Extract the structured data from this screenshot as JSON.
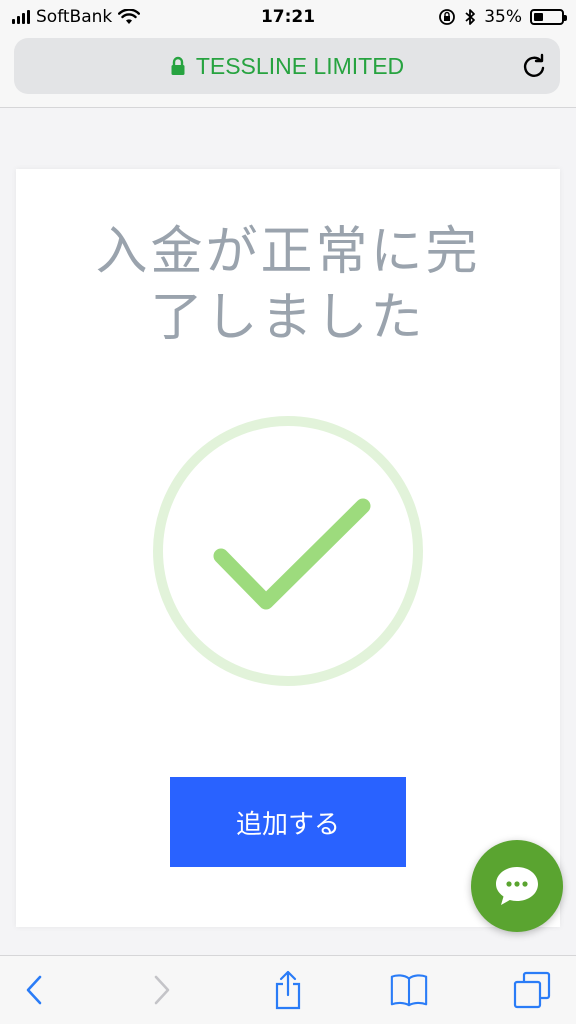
{
  "status_bar": {
    "carrier": "SoftBank",
    "time": "17:21",
    "battery_percent": "35%",
    "battery_level": 0.35,
    "icons": [
      "signal-icon",
      "wifi-icon",
      "orientation-lock-icon",
      "bluetooth-icon",
      "battery-icon"
    ]
  },
  "browser": {
    "url_title": "TESSLINE LIMITED",
    "secure": true,
    "accent_color": "#27a340"
  },
  "page": {
    "title_line1": "入金が正常に完",
    "title_line2": "了しました",
    "success_icon": "check-circle-icon",
    "primary_button_label": "追加する",
    "primary_button_color": "#2962ff",
    "chat_button_color": "#5aa430",
    "chat_icon": "chat-bubble-icon"
  },
  "toolbar": {
    "items": [
      "back-icon",
      "forward-icon",
      "share-icon",
      "bookmarks-icon",
      "tabs-icon"
    ],
    "forward_enabled": false
  }
}
